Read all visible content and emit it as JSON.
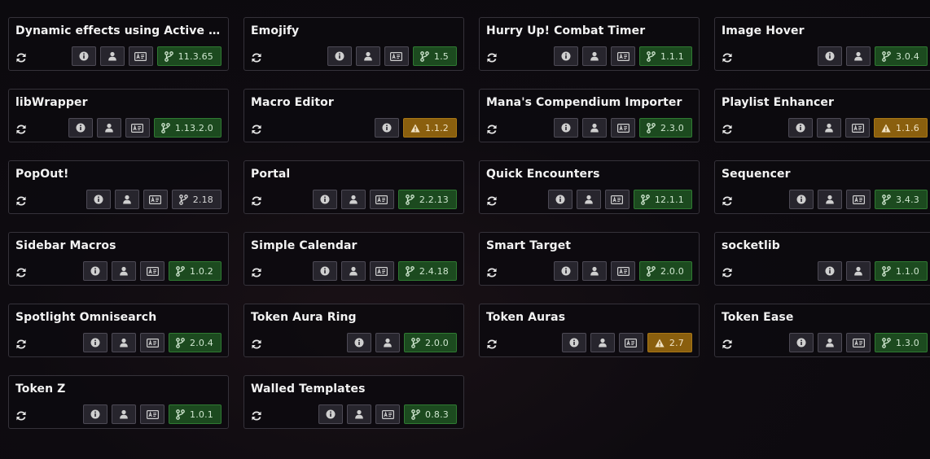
{
  "colors": {
    "ok": "#1c4a1f",
    "warn": "#8a5f0e",
    "button": "#27252d"
  },
  "modules": [
    {
      "title": "Dynamic effects using Active Effe…",
      "version": "11.3.65",
      "status": "ok",
      "buttons": [
        "info-icon",
        "author-icon",
        "readme-icon"
      ]
    },
    {
      "title": "Emojify",
      "version": "1.5",
      "status": "ok",
      "buttons": [
        "info-icon",
        "author-icon",
        "readme-icon"
      ]
    },
    {
      "title": "Hurry Up! Combat Timer",
      "version": "1.1.1",
      "status": "ok",
      "buttons": [
        "info-icon",
        "author-icon",
        "readme-icon"
      ]
    },
    {
      "title": "Image Hover",
      "version": "3.0.4",
      "status": "ok",
      "buttons": [
        "info-icon",
        "author-icon"
      ]
    },
    {
      "title": "libWrapper",
      "version": "1.13.2.0",
      "status": "ok",
      "buttons": [
        "info-icon",
        "author-icon",
        "readme-icon"
      ]
    },
    {
      "title": "Macro Editor",
      "version": "1.1.2",
      "status": "warn",
      "buttons": [
        "info-icon"
      ]
    },
    {
      "title": "Mana's Compendium Importer",
      "version": "2.3.0",
      "status": "ok",
      "buttons": [
        "info-icon",
        "author-icon",
        "readme-icon"
      ]
    },
    {
      "title": "Playlist Enhancer",
      "version": "1.1.6",
      "status": "warn",
      "buttons": [
        "info-icon",
        "author-icon",
        "readme-icon"
      ]
    },
    {
      "title": "PopOut!",
      "version": "2.18",
      "status": "neutral",
      "buttons": [
        "info-icon",
        "author-icon",
        "readme-icon"
      ]
    },
    {
      "title": "Portal",
      "version": "2.2.13",
      "status": "ok",
      "buttons": [
        "info-icon",
        "author-icon",
        "readme-icon"
      ]
    },
    {
      "title": "Quick Encounters",
      "version": "12.1.1",
      "status": "ok",
      "buttons": [
        "info-icon",
        "author-icon",
        "readme-icon"
      ]
    },
    {
      "title": "Sequencer",
      "version": "3.4.3",
      "status": "ok",
      "buttons": [
        "info-icon",
        "author-icon",
        "readme-icon"
      ]
    },
    {
      "title": "Sidebar Macros",
      "version": "1.0.2",
      "status": "ok",
      "buttons": [
        "info-icon",
        "author-icon",
        "readme-icon"
      ]
    },
    {
      "title": "Simple Calendar",
      "version": "2.4.18",
      "status": "ok",
      "buttons": [
        "info-icon",
        "author-icon",
        "readme-icon"
      ]
    },
    {
      "title": "Smart Target",
      "version": "2.0.0",
      "status": "ok",
      "buttons": [
        "info-icon",
        "author-icon",
        "readme-icon"
      ]
    },
    {
      "title": "socketlib",
      "version": "1.1.0",
      "status": "ok",
      "buttons": [
        "info-icon",
        "author-icon"
      ]
    },
    {
      "title": "Spotlight Omnisearch",
      "version": "2.0.4",
      "status": "ok",
      "buttons": [
        "info-icon",
        "author-icon",
        "readme-icon"
      ]
    },
    {
      "title": "Token Aura Ring",
      "version": "2.0.0",
      "status": "ok",
      "buttons": [
        "info-icon",
        "author-icon"
      ]
    },
    {
      "title": "Token Auras",
      "version": "2.7",
      "status": "warn",
      "buttons": [
        "info-icon",
        "author-icon",
        "readme-icon"
      ]
    },
    {
      "title": "Token Ease",
      "version": "1.3.0",
      "status": "ok",
      "buttons": [
        "info-icon",
        "author-icon",
        "readme-icon"
      ]
    },
    {
      "title": "Token Z",
      "version": "1.0.1",
      "status": "ok",
      "buttons": [
        "info-icon",
        "author-icon",
        "readme-icon"
      ]
    },
    {
      "title": "Walled Templates",
      "version": "0.8.3",
      "status": "ok",
      "buttons": [
        "info-icon",
        "author-icon",
        "readme-icon"
      ]
    }
  ]
}
